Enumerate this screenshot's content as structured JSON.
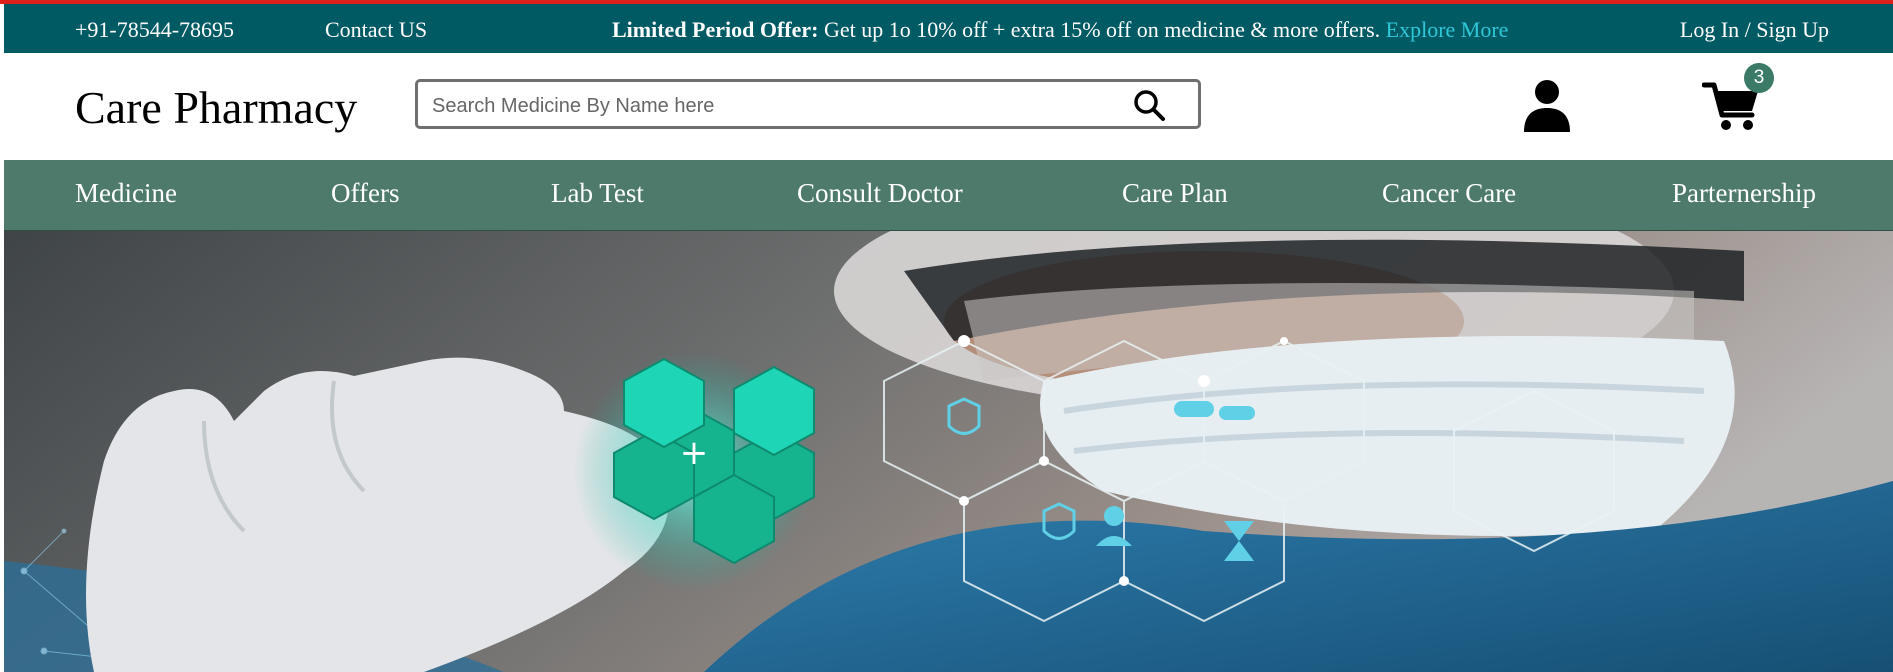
{
  "topbar": {
    "phone": "+91-78544-78695",
    "contact": "Contact US",
    "offer_label": "Limited Period Offer:",
    "offer_text": " Get up 1o 10% off + extra 15% off on medicine & more offers. ",
    "offer_link": "Explore More",
    "login": "Log In / Sign Up"
  },
  "header": {
    "logo": "Care Pharmacy",
    "search_placeholder": "Search Medicine By Name here",
    "search_value": "",
    "cart_count": "3"
  },
  "nav": {
    "items": [
      "Medicine",
      "Offers",
      "Lab Test",
      "Consult Doctor",
      "Care Plan",
      "Cancer Care",
      "Parternership"
    ]
  },
  "colors": {
    "topbar_bg": "#005a64",
    "accent_red": "#e0201c",
    "link": "#2ec7d8",
    "nav_bg": "#4e7a6c",
    "badge": "#3b7a67"
  },
  "icons": {
    "search": "search-icon",
    "user": "user-icon",
    "cart": "cart-icon"
  }
}
